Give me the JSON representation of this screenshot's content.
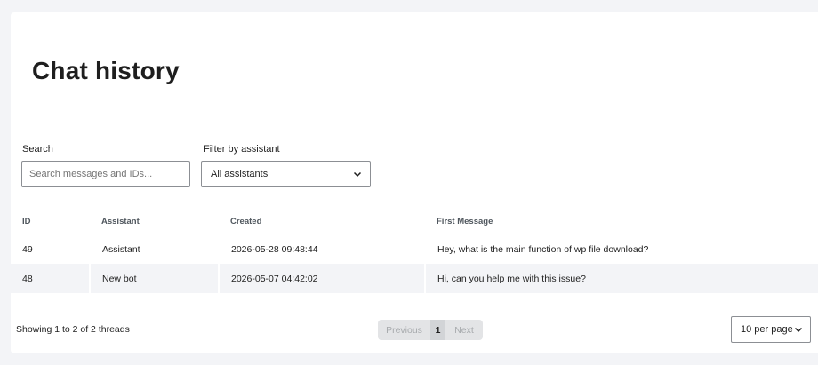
{
  "page": {
    "title": "Chat history"
  },
  "search": {
    "label": "Search",
    "placeholder": "Search messages and IDs...",
    "value": ""
  },
  "filter": {
    "label": "Filter by assistant",
    "selected": "All assistants"
  },
  "table": {
    "headers": {
      "id": "ID",
      "assistant": "Assistant",
      "created": "Created",
      "first_message": "First Message"
    },
    "rows": [
      {
        "id": "49",
        "assistant": "Assistant",
        "created": "2026-05-28 09:48:44",
        "first_message": "Hey, what is the main function of wp file download?"
      },
      {
        "id": "48",
        "assistant": "New bot",
        "created": "2026-05-07 04:42:02",
        "first_message": "Hi, can you help me with this issue?"
      }
    ]
  },
  "footer": {
    "showing": "Showing 1 to 2 of 2 threads",
    "pagination": {
      "previous": "Previous",
      "current_page": "1",
      "next": "Next"
    },
    "per_page": "10 per page"
  },
  "icons": {
    "dropdown": "chevron-down-icon"
  },
  "colors": {
    "background": "#f3f4f7",
    "card": "#ffffff",
    "row_alt": "#f3f4f7",
    "border": "#8c8f94"
  }
}
